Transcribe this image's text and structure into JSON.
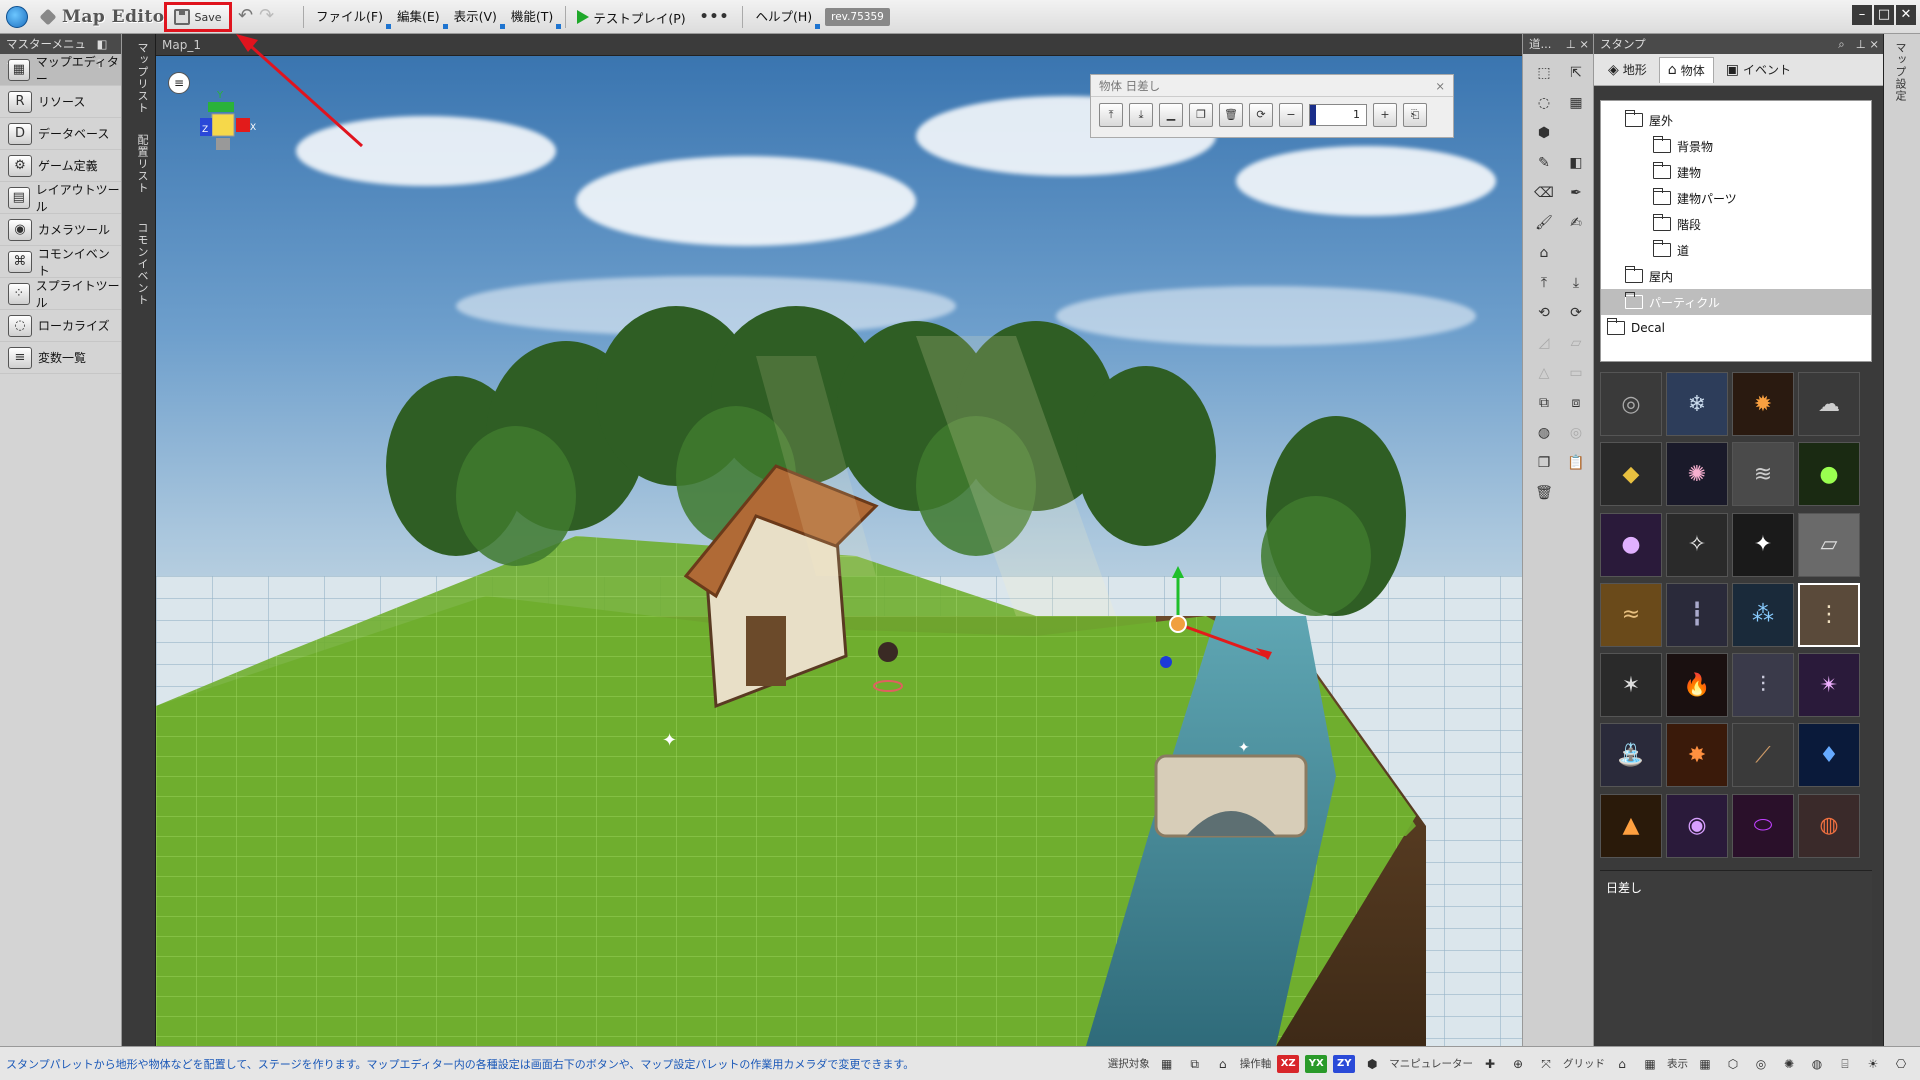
{
  "app": {
    "title": "Map Editor",
    "save_label": "Save",
    "rev_badge": "rev.75359"
  },
  "menubar": {
    "items": [
      "ファイル(F)",
      "編集(E)",
      "表示(V)",
      "機能(T)"
    ],
    "test_play": "テストプレイ(P)",
    "more": "•••",
    "help": "ヘルプ(H)"
  },
  "master_menu": {
    "header": "マスターメニュー",
    "items": [
      {
        "label": "マップエディター",
        "icon": "map-editor-icon",
        "active": true
      },
      {
        "label": "リソース",
        "icon": "resource-icon"
      },
      {
        "label": "データベース",
        "icon": "database-icon"
      },
      {
        "label": "ゲーム定義",
        "icon": "game-definition-icon"
      },
      {
        "label": "レイアウトツール",
        "icon": "layout-tool-icon"
      },
      {
        "label": "カメラツール",
        "icon": "camera-tool-icon"
      },
      {
        "label": "コモンイベント",
        "icon": "common-event-icon"
      },
      {
        "label": "スプライトツール",
        "icon": "sprite-tool-icon"
      },
      {
        "label": "ローカライズ",
        "icon": "localize-icon"
      },
      {
        "label": "変数一覧",
        "icon": "variable-list-icon"
      }
    ]
  },
  "side_tabs": [
    "マップリスト",
    "配置リスト",
    "コモンイベント"
  ],
  "viewport": {
    "tab": "Map_1",
    "object_toolbar_title": "物体 日差し",
    "object_number": "1"
  },
  "tool_panel": {
    "header": "道..."
  },
  "stamp_panel": {
    "header": "スタンプ",
    "tabs": [
      {
        "label": "地形",
        "icon": "terrain-icon"
      },
      {
        "label": "物体",
        "icon": "object-icon",
        "active": true
      },
      {
        "label": "イベント",
        "icon": "event-icon"
      }
    ],
    "tree": [
      {
        "label": "屋外",
        "depth": 1
      },
      {
        "label": "背景物",
        "depth": 2
      },
      {
        "label": "建物",
        "depth": 2
      },
      {
        "label": "建物パーツ",
        "depth": 2
      },
      {
        "label": "階段",
        "depth": 2
      },
      {
        "label": "道",
        "depth": 2
      },
      {
        "label": "屋内",
        "depth": 1
      },
      {
        "label": "パーティクル",
        "depth": 1,
        "selected": true
      },
      {
        "label": "Decal",
        "depth": 0
      }
    ],
    "selected_name": "日差し"
  },
  "right_tab": "マップ設定",
  "statusbar": {
    "message": "スタンプパレットから地形や物体などを配置して、ステージを作ります。マップエディター内の各種設定は画面右下のボタンや、マップ設定パレットの作業用カメラダで変更できます。",
    "selection_target": "選択対象",
    "operation_axis": "操作軸",
    "axis_xz": "XZ",
    "axis_yx": "YX",
    "axis_zy": "ZY",
    "manipulator": "マニピュレーター",
    "grid": "グリッド",
    "display": "表示"
  },
  "colors": {
    "save_highlight": "#e0141e",
    "accent_blue": "#1e74d0",
    "play_green": "#1fa82a"
  }
}
